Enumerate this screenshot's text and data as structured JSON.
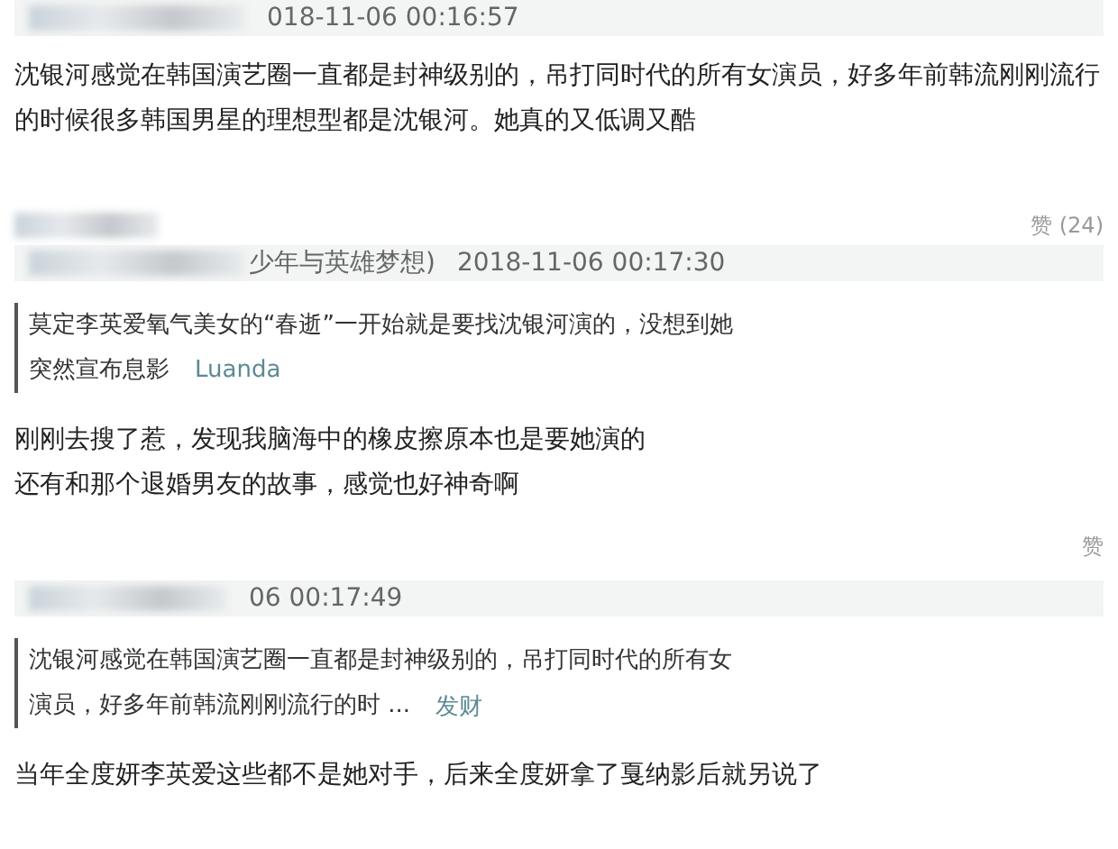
{
  "comments": [
    {
      "time": "018-11-06 00:16:57",
      "body": [
        "沈银河感觉在韩国演艺圈一直都是封神级别的，吊打同时代的所有女演员，好多年前韩流刚刚流行",
        "的时候很多韩国男星的理想型都是沈银河。她真的又低调又酷"
      ],
      "like": "赞 (24)"
    },
    {
      "header_text": "少年与英雄梦想)",
      "time": "2018-11-06 00:17:30",
      "quote": {
        "lines": [
          "莫定李英爱氧气美女的“春逝”一开始就是要找沈银河演的，没想到她",
          "突然宣布息影"
        ],
        "author": "Luanda"
      },
      "body": [
        "刚刚去搜了惹，发现我脑海中的橡皮擦原本也是要她演的",
        "还有和那个退婚男友的故事，感觉也好神奇啊"
      ],
      "like": "赞"
    },
    {
      "time": "06 00:17:49",
      "quote": {
        "lines": [
          "沈银河感觉在韩国演艺圈一直都是封神级别的，吊打同时代的所有女",
          "演员，好多年前韩流刚刚流行的时 ..."
        ],
        "author": "发财"
      },
      "body": [
        "当年全度妍李英爱这些都不是她对手，后来全度妍拿了戛纳影后就另说了"
      ]
    }
  ]
}
